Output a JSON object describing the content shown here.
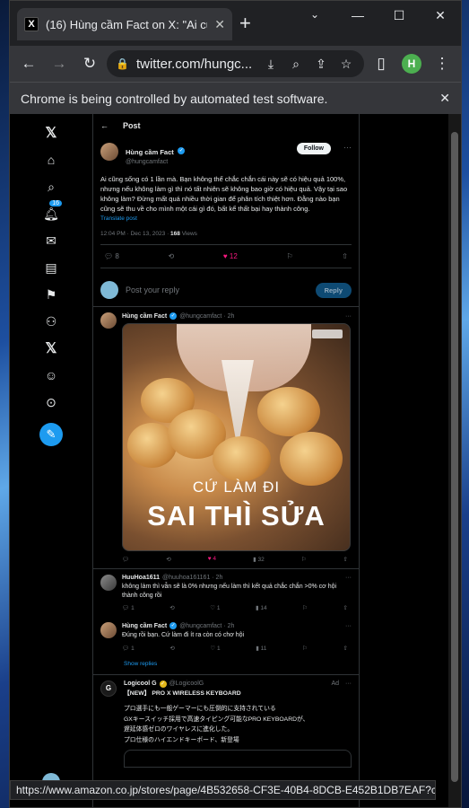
{
  "browser": {
    "tab_title": "(16) Hùng cầm Fact on X: \"Ai cũ",
    "tab_favicon": "X",
    "url": "twitter.com/hungc...",
    "profile_initial": "H",
    "infobar_text": "Chrome is being controlled by automated test software.",
    "status_url": "https://www.amazon.co.jp/stores/page/4B532658-CF3E-40B4-8DCB-E452B1DB7EAF?c..."
  },
  "nav": {
    "notification_badge": "16"
  },
  "post": {
    "header": "Post",
    "author": "Hùng cầm Fact",
    "handle": "@hungcamfact",
    "follow_label": "Follow",
    "text": "Ai cũng sống có 1 lần mà. Bạn không thể chắc chắn cái này sẽ có hiệu quả 100%, nhưng nếu không làm gì thì nó tất nhiên sẽ không bao giờ có hiệu quả. Vậy tại sao không làm? Đừng mất quá nhiều thời gian để phân tích thiệt hơn. Đằng nào bạn cũng sẽ thu về cho mình một cái gì đó, bất kể thất bại hay thành công.",
    "translate": "Translate post",
    "time": "12:04 PM · Dec 13, 2023 · ",
    "views": "168",
    "views_label": " Views",
    "replies": "8",
    "likes": "12"
  },
  "reply_box": {
    "placeholder": "Post your reply",
    "button": "Reply"
  },
  "replies": [
    {
      "author": "Hùng cầm Fact",
      "handle": "@hungcamfact · 2h",
      "image_line1": "CỨ LÀM ĐI",
      "image_line2": "SAI THÌ SỬA",
      "likes": "4",
      "views": "32"
    },
    {
      "author": "HuuHoa1611",
      "handle": "@huuhoa161161 · 2h",
      "text": "không làm thì vẫn sẽ là 0% nhưng nếu làm thì kết quả chắc chắn >0% cơ hội thành công rồi",
      "replies": "1",
      "likes": "1",
      "views": "14"
    },
    {
      "author": "Hùng cầm Fact",
      "handle": "@hungcamfact · 2h",
      "text": "Đúng rồi bạn. Cứ làm đi ít ra còn có chơ hội",
      "replies": "1",
      "likes": "1",
      "views": "11"
    }
  ],
  "show_replies": "Show replies",
  "ad": {
    "author": "Logicool G",
    "handle": "@LogicoolG",
    "label": "Ad",
    "title": "【NEW】 PRO X WIRELESS KEYBOARD",
    "lines": [
      "プロ選手にも一般ゲーマーにも圧倒的に支持されている",
      "GXキースイッチ採用で高速タイピング可能なPRO KEYBOARDが、",
      "遅延体感ゼロのワイヤレスに進化した。",
      "プロ仕様のハイエンドキーボード、新登場"
    ]
  }
}
